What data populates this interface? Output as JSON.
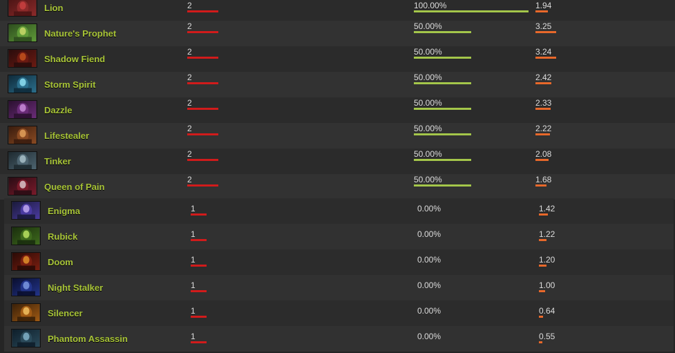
{
  "colors": {
    "hero_name": "#a7c337",
    "matches_bar": "#d11b1b",
    "winrate_bar": "#a4c64a",
    "kda_bar": "#e8682a"
  },
  "rows": [
    {
      "hero": "Lion",
      "icon": "lion-portrait-icon",
      "matches": "2",
      "winrate": "100.00%",
      "kda": "1.94"
    },
    {
      "hero": "Nature's Prophet",
      "icon": "natures-prophet-portrait-icon",
      "matches": "2",
      "winrate": "50.00%",
      "kda": "3.25"
    },
    {
      "hero": "Shadow Fiend",
      "icon": "shadow-fiend-portrait-icon",
      "matches": "2",
      "winrate": "50.00%",
      "kda": "3.24"
    },
    {
      "hero": "Storm Spirit",
      "icon": "storm-spirit-portrait-icon",
      "matches": "2",
      "winrate": "50.00%",
      "kda": "2.42"
    },
    {
      "hero": "Dazzle",
      "icon": "dazzle-portrait-icon",
      "matches": "2",
      "winrate": "50.00%",
      "kda": "2.33"
    },
    {
      "hero": "Lifestealer",
      "icon": "lifestealer-portrait-icon",
      "matches": "2",
      "winrate": "50.00%",
      "kda": "2.22"
    },
    {
      "hero": "Tinker",
      "icon": "tinker-portrait-icon",
      "matches": "2",
      "winrate": "50.00%",
      "kda": "2.08"
    },
    {
      "hero": "Queen of Pain",
      "icon": "queen-of-pain-portrait-icon",
      "matches": "2",
      "winrate": "50.00%",
      "kda": "1.68"
    },
    {
      "hero": "Enigma",
      "icon": "enigma-portrait-icon",
      "matches": "1",
      "winrate": "0.00%",
      "kda": "1.42"
    },
    {
      "hero": "Rubick",
      "icon": "rubick-portrait-icon",
      "matches": "1",
      "winrate": "0.00%",
      "kda": "1.22"
    },
    {
      "hero": "Doom",
      "icon": "doom-portrait-icon",
      "matches": "1",
      "winrate": "0.00%",
      "kda": "1.20"
    },
    {
      "hero": "Night Stalker",
      "icon": "night-stalker-portrait-icon",
      "matches": "1",
      "winrate": "0.00%",
      "kda": "1.00"
    },
    {
      "hero": "Silencer",
      "icon": "silencer-portrait-icon",
      "matches": "1",
      "winrate": "0.00%",
      "kda": "0.64"
    },
    {
      "hero": "Phantom Assassin",
      "icon": "phantom-assassin-portrait-icon",
      "matches": "1",
      "winrate": "0.00%",
      "kda": "0.55"
    }
  ]
}
